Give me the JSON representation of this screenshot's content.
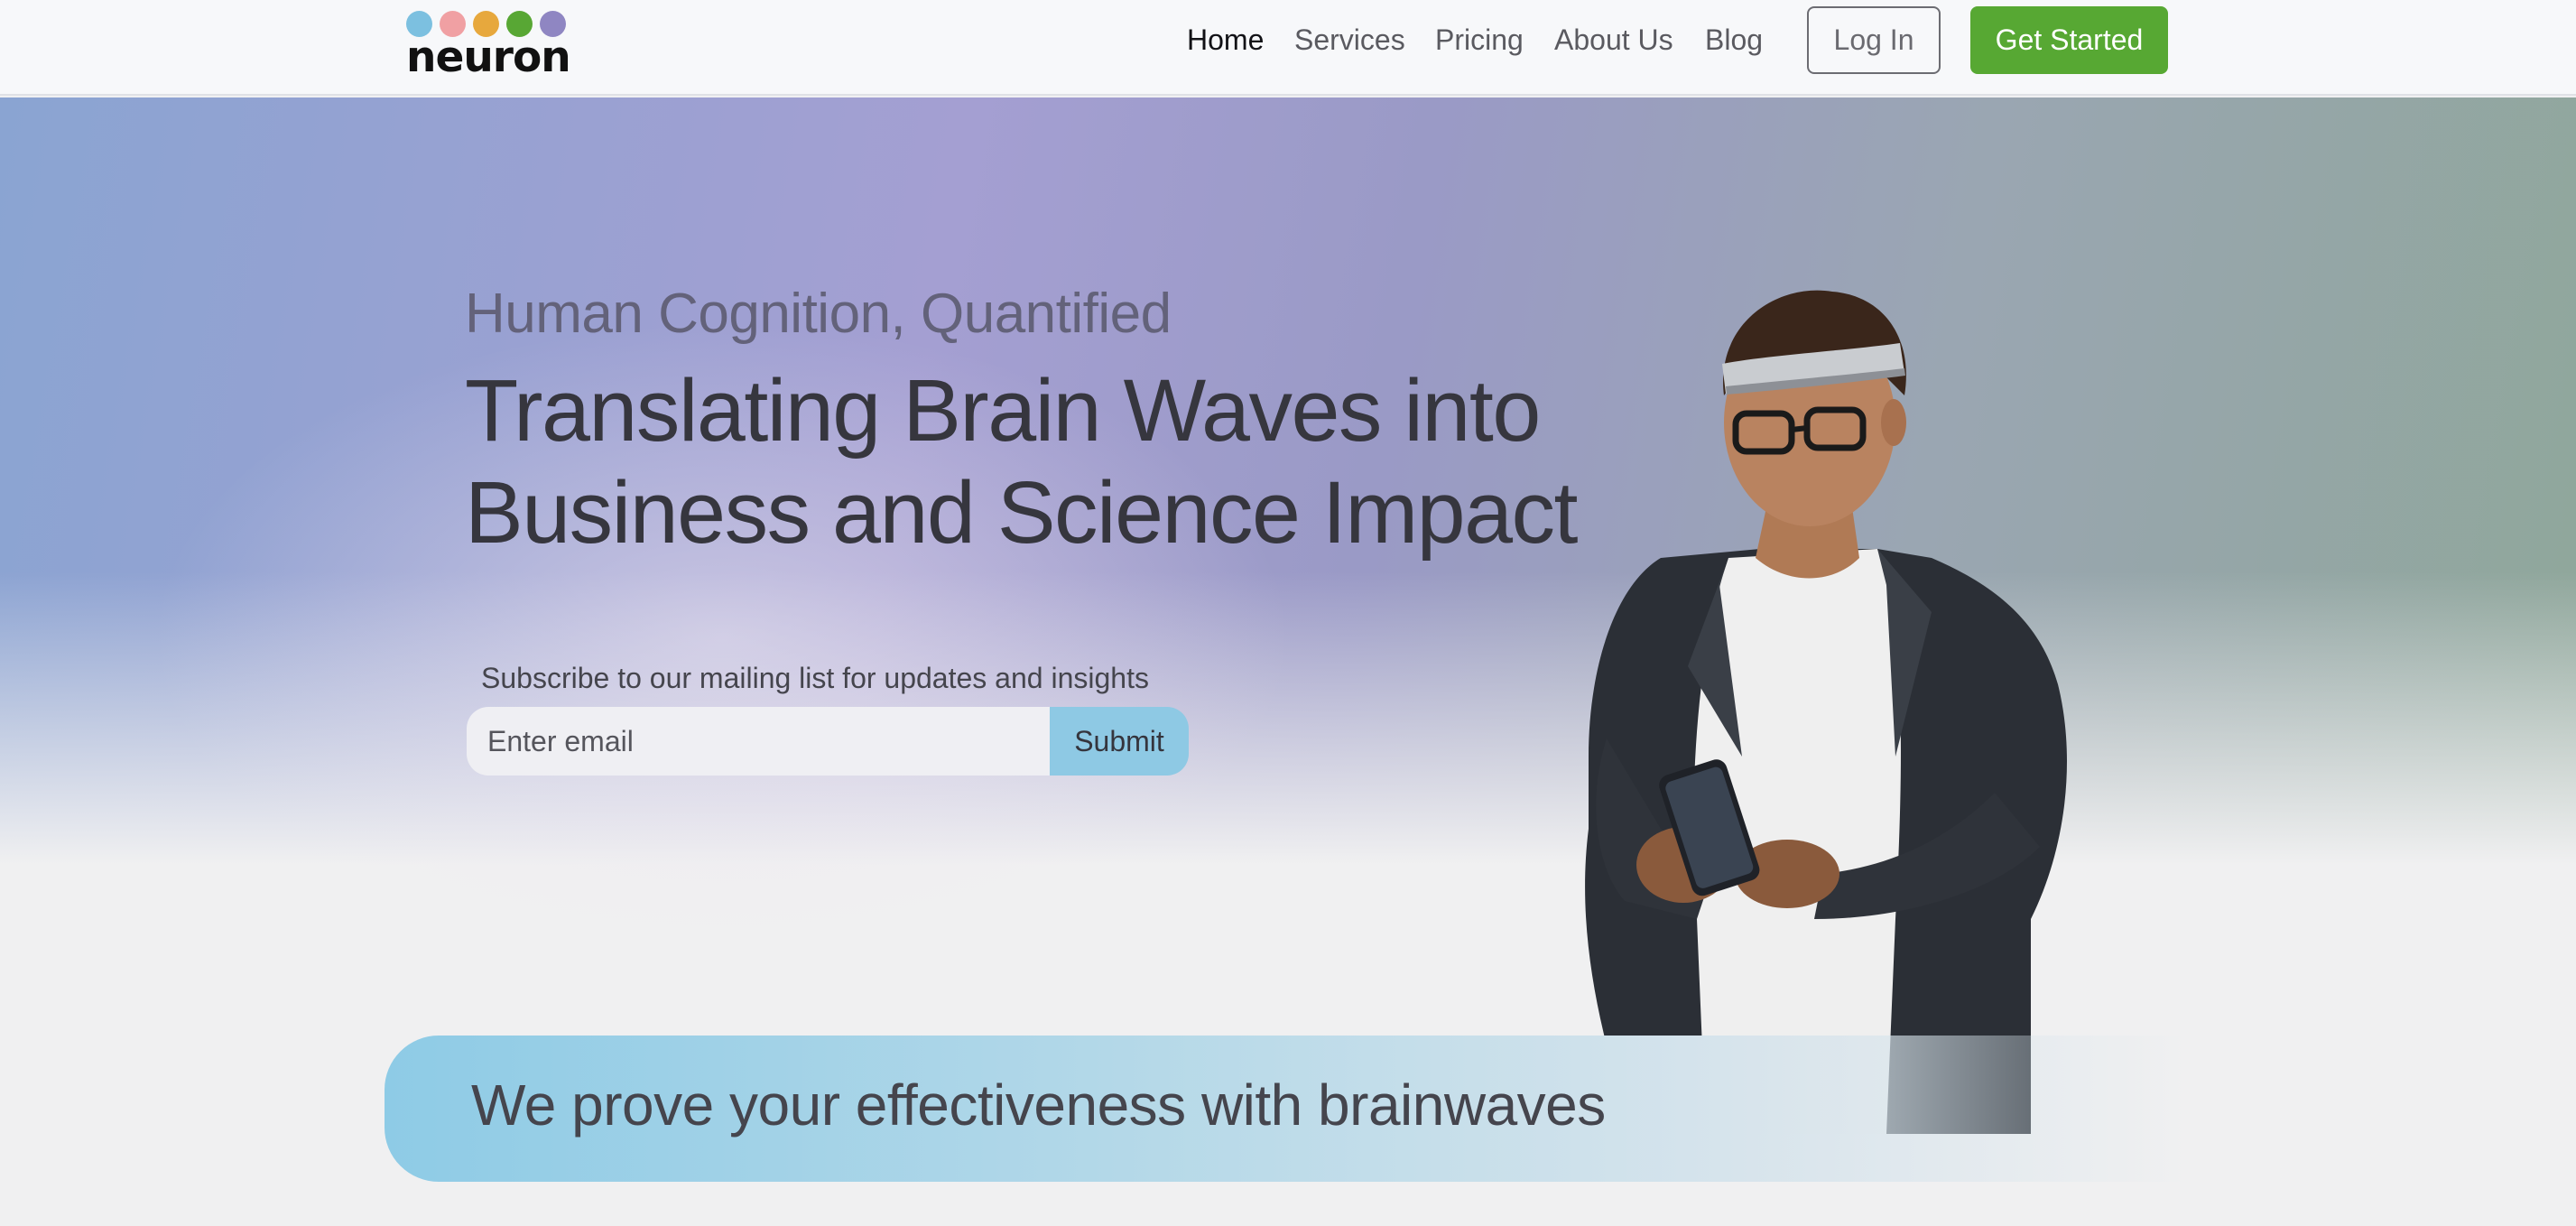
{
  "brand": {
    "name": "neuron",
    "logo_dot_colors": [
      "#7cc0e0",
      "#f0a0a3",
      "#e7a83d",
      "#58a734",
      "#8f86c2"
    ]
  },
  "nav": {
    "links": [
      {
        "label": "Home",
        "active": true
      },
      {
        "label": "Services",
        "active": false
      },
      {
        "label": "Pricing",
        "active": false
      },
      {
        "label": "About Us",
        "active": false
      },
      {
        "label": "Blog",
        "active": false
      }
    ],
    "login_label": "Log In",
    "get_started_label": "Get Started"
  },
  "hero": {
    "kicker": "Human Cognition, Quantified",
    "headline_line1": "Translating Brain Waves into",
    "headline_line2": "Business and Science Impact",
    "subscribe_label": "Subscribe to our mailing list for updates and insights",
    "email_placeholder": "Enter email",
    "submit_label": "Submit"
  },
  "banner": {
    "text": "We prove your effectiveness with brainwaves"
  },
  "colors": {
    "accent_green": "#57a833",
    "accent_blue": "#8ec9e4"
  },
  "icons": {
    "hero_image": "person-with-eeg-headband-using-phone"
  }
}
